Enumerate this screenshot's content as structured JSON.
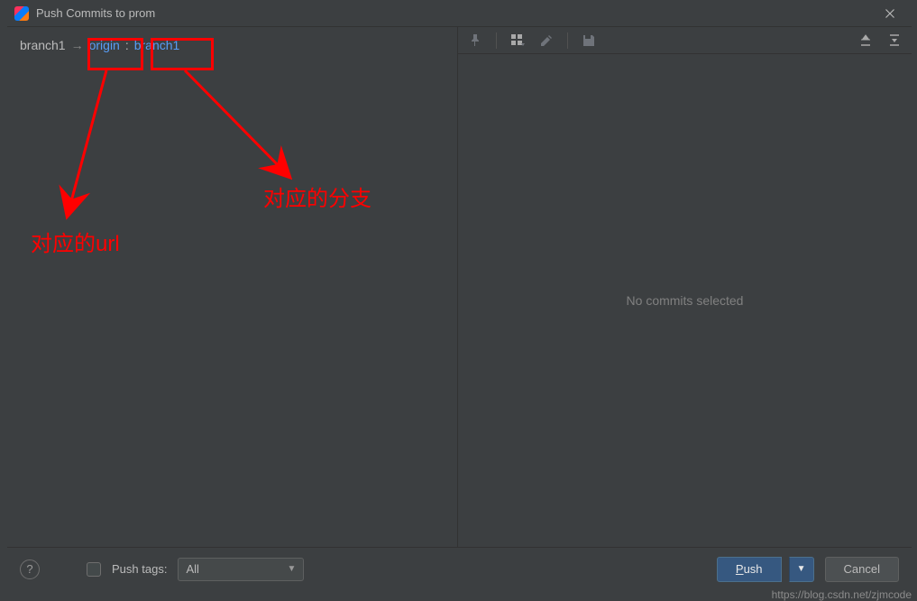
{
  "title": "Push Commits to prom",
  "branch": {
    "local": "branch1",
    "arrow": "→",
    "remote": "origin",
    "sep": ":",
    "target": "branch1"
  },
  "preview": {
    "empty_text": "No commits selected"
  },
  "footer": {
    "push_tags_label": "Push tags:",
    "combo_value": "All",
    "push_label": "Push",
    "cancel_label": "Cancel"
  },
  "annotations": {
    "url_label": "对应的url",
    "branch_label": "对应的分支"
  },
  "watermark": "https://blog.csdn.net/zjmcode"
}
